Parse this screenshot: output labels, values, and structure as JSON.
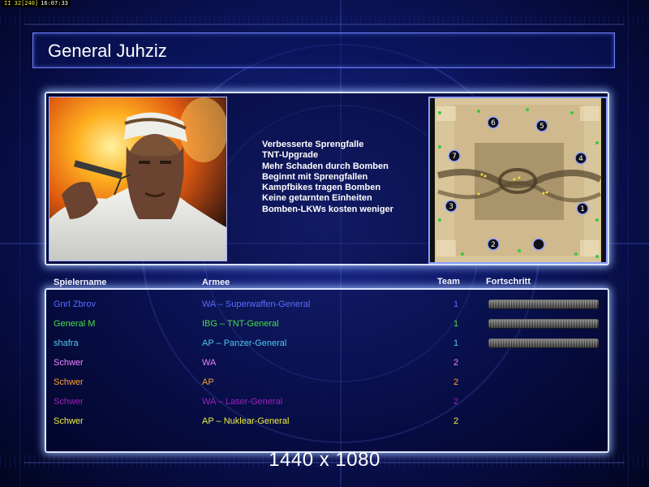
{
  "hud": {
    "fps": "II 32[240]",
    "clock": "16:07:33"
  },
  "title": "General Juhziz",
  "traits": [
    "Verbesserte Sprengfalle",
    "TNT-Upgrade",
    "Mehr Schaden durch Bomben",
    "Beginnt mit Sprengfallen",
    "Kampfbikes tragen Bomben",
    "Keine getarnten Einheiten",
    "Bomben-LKWs kosten weniger"
  ],
  "minimap": {
    "start_positions": [
      "6",
      "5",
      "7",
      "4",
      "3",
      "1",
      "2",
      ""
    ]
  },
  "columns": {
    "name": "Spielername",
    "army": "Armee",
    "team": "Team",
    "progress": "Fortschritt"
  },
  "players": [
    {
      "name": "Gnrl Zbrov",
      "army": "WA – Superwaffen-General",
      "team": "1",
      "color": "#5a6cff",
      "progress": 1.0
    },
    {
      "name": "General M",
      "army": "IBG – TNT-General",
      "team": "1",
      "color": "#46e046",
      "progress": 1.0
    },
    {
      "name": "shafra",
      "army": "AP – Panzer-General",
      "team": "1",
      "color": "#4fc8f0",
      "progress": 1.0
    },
    {
      "name": "Schwer",
      "army": "WA",
      "team": "2",
      "color": "#f080ff"
    },
    {
      "name": "Schwer",
      "army": "AP",
      "team": "2",
      "color": "#ffa030"
    },
    {
      "name": "Schwer",
      "army": "WA – Laser-General",
      "team": "2",
      "color": "#a020c0"
    },
    {
      "name": "Schwer",
      "army": "AP – Nuklear-General",
      "team": "2",
      "color": "#f0f040"
    }
  ],
  "resolution": "1440 x 1080",
  "colors": {
    "panel_border": "#d8e4ff",
    "background": "#0c1660"
  }
}
